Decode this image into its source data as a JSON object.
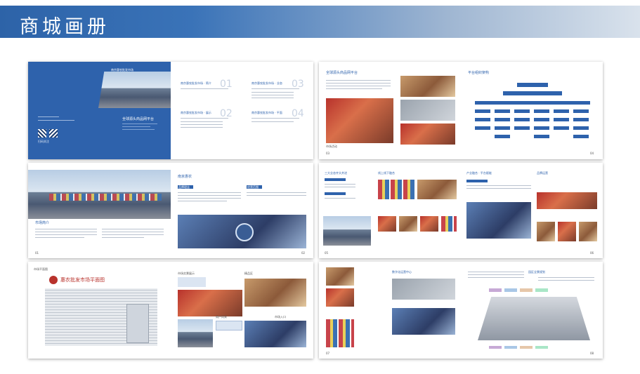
{
  "header": {
    "title": "商城画册",
    "accent_color": "#2e62ac"
  },
  "spreads": [
    {
      "id": "cover",
      "left": {
        "logo_text": "南京惠农批发市场",
        "qr_label": "扫码关注"
      },
      "right": {
        "main_title": "全球源头商品网平台",
        "toc": [
          {
            "title": "南京惠农批发市场 · 简介",
            "no": "01"
          },
          {
            "title": "南京惠农批发市场 · 业态",
            "no": "03"
          },
          {
            "title": "南京惠农批发市场 · 展示",
            "no": "02"
          },
          {
            "title": "南京惠农批发市场 · 平面",
            "no": "04"
          }
        ]
      }
    },
    {
      "id": "intro",
      "left": {
        "section_label": "市场简介",
        "page_no": "01"
      },
      "right": {
        "title": "南京惠农",
        "tag1": "品牌理念",
        "tag2": "经营范围",
        "page_no": "02"
      }
    },
    {
      "id": "floorplan",
      "left": {
        "section_label": "市场平面图",
        "plan_title": "惠农批发市场平面图"
      },
      "right": {
        "captions": [
          "市场实景展示",
          "精品区",
          "商户风采",
          "市场入口"
        ]
      }
    },
    {
      "id": "platform",
      "left": {
        "title": "全球源头商品网平台",
        "photo_caption": "市场活动",
        "page_no": "03"
      },
      "right": {
        "title": "平台组织架构",
        "page_no": "04"
      }
    },
    {
      "id": "business",
      "left": {
        "title": "三大业态齐头并进",
        "subtitle": "线上线下融合",
        "page_no": "05"
      },
      "right": {
        "title": "产业融合 · 平台赋能",
        "subtitle": "品牌运营",
        "page_no": "06"
      }
    },
    {
      "id": "display",
      "left": {
        "title": "数字化运营中心",
        "page_no": "07"
      },
      "right": {
        "title": "园区全景规划",
        "page_no": "08"
      }
    }
  ]
}
